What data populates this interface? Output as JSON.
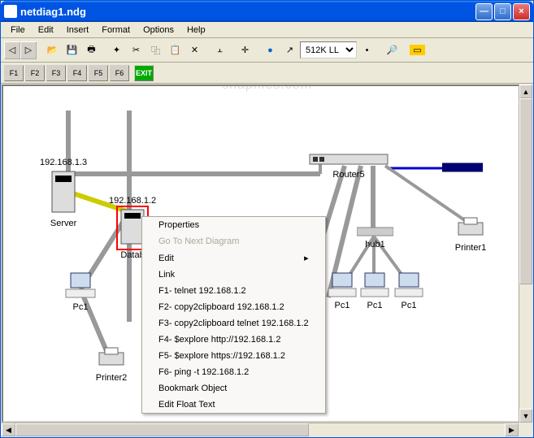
{
  "window": {
    "title": "netdiag1.ndg"
  },
  "menu": {
    "file": "File",
    "edit": "Edit",
    "insert": "Insert",
    "format": "Format",
    "options": "Options",
    "help": "Help"
  },
  "toolbar": {
    "combo": "512K LL"
  },
  "funcbar": {
    "f1": "F1",
    "f2": "F2",
    "f3": "F3",
    "f4": "F4",
    "f5": "F5",
    "f6": "F6",
    "exit": "EXIT"
  },
  "watermark": "snapfiles.com",
  "nodes": {
    "server": {
      "ip": "192.168.1.3",
      "label": "Server"
    },
    "database": {
      "ip": "192.168.1.2",
      "label": "Datab"
    },
    "pc_left": {
      "label": "Pc1"
    },
    "printer2": {
      "label": "Printer2"
    },
    "router5": {
      "label": "Router5"
    },
    "hub1": {
      "label": "hub1"
    },
    "pc_r1": {
      "label": "Pc1"
    },
    "pc_r2": {
      "label": "Pc1"
    },
    "pc_r3": {
      "label": "Pc1"
    },
    "printer1": {
      "label": "Printer1"
    }
  },
  "context_menu": {
    "properties": "Properties",
    "goto": "Go To Next Diagram",
    "edit": "Edit",
    "link": "Link",
    "f1": "F1- telnet 192.168.1.2",
    "f2": "F2- copy2clipboard 192.168.1.2",
    "f3": "F3- copy2clipboard telnet 192.168.1.2",
    "f4": "F4- $explore http://192.168.1.2",
    "f5": "F5- $explore https://192.168.1.2",
    "f6": "F6- ping -t 192.168.1.2",
    "bookmark": "Bookmark Object",
    "floattext": "Edit Float Text"
  }
}
